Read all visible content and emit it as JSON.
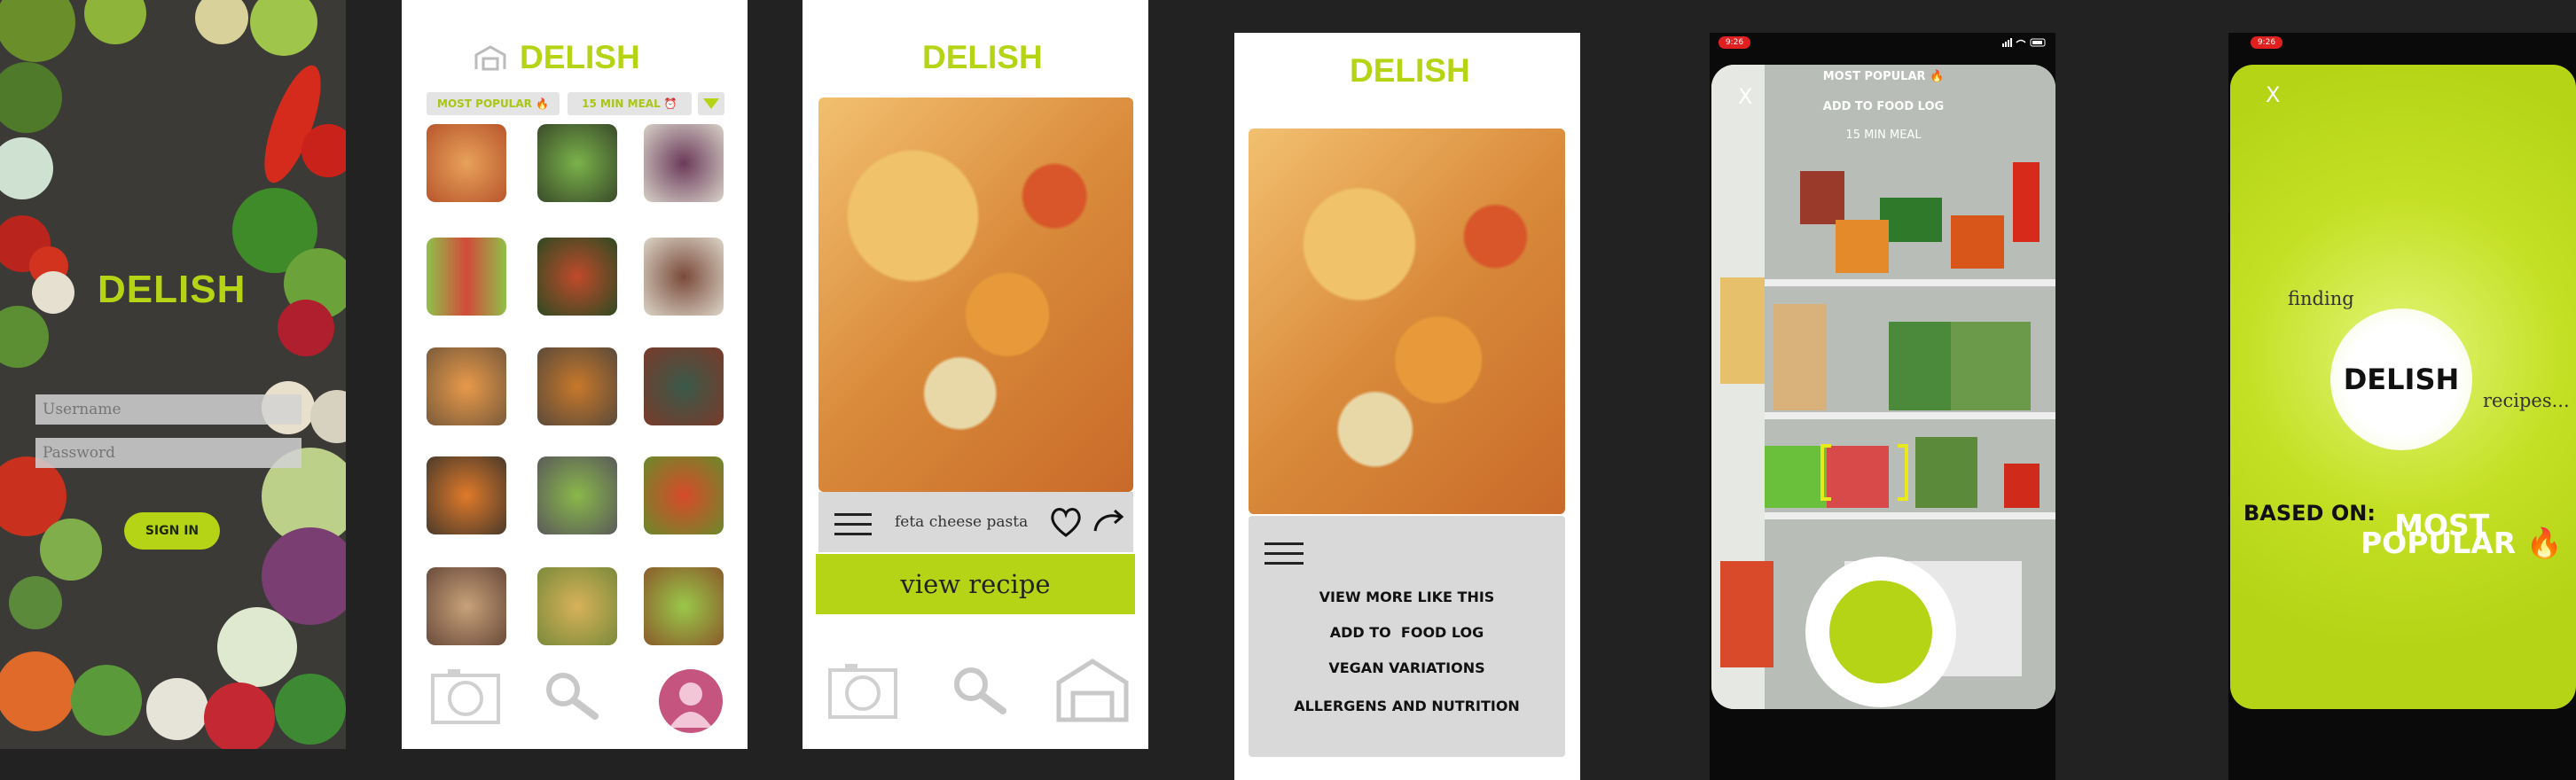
{
  "colors": {
    "accent": "#b5d416",
    "background": "#222222",
    "panel": "#ffffff",
    "gray": "#d9d9d9",
    "pink": "#c5557e"
  },
  "screen1": {
    "title": "DELISH",
    "username_placeholder": "Username",
    "password_placeholder": "Password",
    "sign_in_label": "SIGN IN"
  },
  "screen2": {
    "title": "DELISH",
    "filter_popular": "MOST POPULAR 🔥",
    "filter_fast": "15 MIN MEAL ⏰",
    "nav_icons": [
      "camera-icon",
      "search-icon",
      "profile-icon"
    ]
  },
  "screen3": {
    "title": "DELISH",
    "recipe_name": "feta cheese pasta",
    "view_recipe_label": "view recipe",
    "nav_icons": [
      "camera-icon",
      "search-icon",
      "home-icon"
    ]
  },
  "screen4": {
    "title": "DELISH",
    "menu_items": [
      "VIEW MORE LIKE THIS",
      "ADD TO  FOOD LOG",
      "VEGAN VARIATIONS",
      "ALLERGENS AND NUTRITION"
    ]
  },
  "screen5": {
    "status_time": "9:26",
    "close_label": "X",
    "overlay_items": [
      "MOST POPULAR 🔥",
      "ADD TO FOOD LOG",
      "15 MIN MEAL"
    ]
  },
  "screen6": {
    "status_time": "9:26",
    "close_label": "X",
    "finding_label": "finding",
    "brand": "DELISH",
    "recipes_label": "recipes...",
    "based_on_label": "BASED ON:",
    "most_label": "MOST",
    "popular_label": "POPULAR 🔥"
  }
}
